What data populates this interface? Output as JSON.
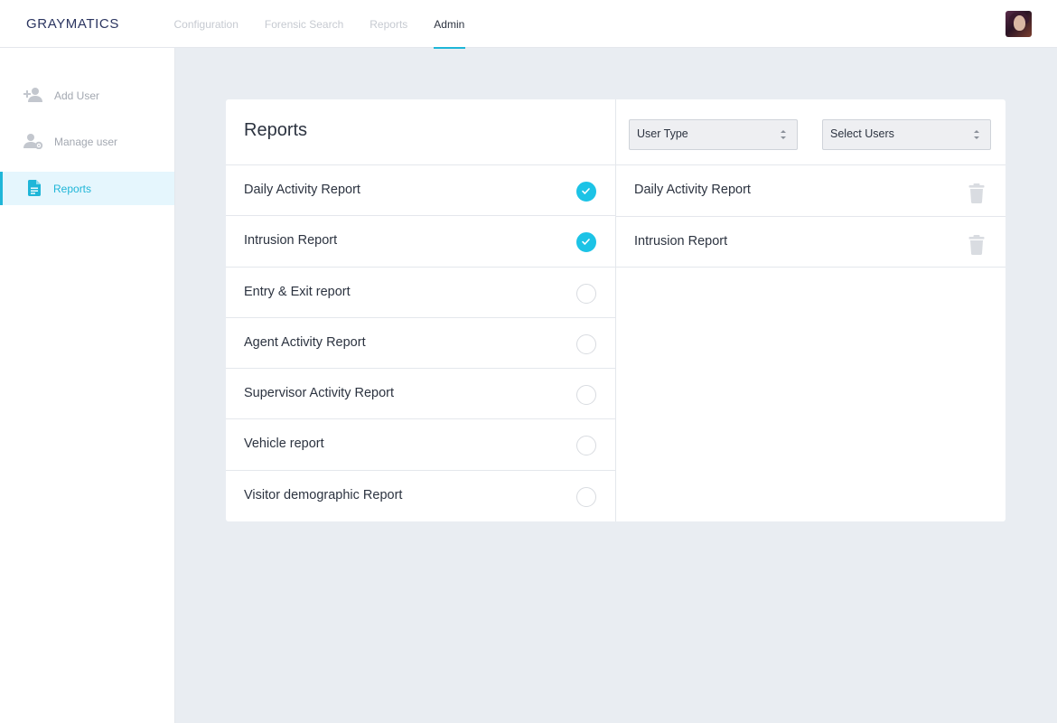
{
  "app": {
    "brand": "GRAYMATICS"
  },
  "nav": [
    {
      "label": "Configuration"
    },
    {
      "label": "Forensic Search"
    },
    {
      "label": "Reports"
    },
    {
      "label": "Admin",
      "active": true
    }
  ],
  "sidebar": {
    "items": [
      {
        "label": "Add User",
        "icon": "add-user-icon"
      },
      {
        "label": "Manage user",
        "icon": "manage-user-icon"
      },
      {
        "label": "Reports",
        "icon": "document-icon",
        "active": true
      }
    ]
  },
  "reports_panel": {
    "title": "Reports",
    "items": [
      {
        "label": "Daily Activity Report",
        "checked": true
      },
      {
        "label": "Intrusion Report",
        "checked": true
      },
      {
        "label": "Entry & Exit report",
        "checked": false
      },
      {
        "label": "Agent Activity Report",
        "checked": false
      },
      {
        "label": "Supervisor Activity Report",
        "checked": false
      },
      {
        "label": "Vehicle report",
        "checked": false
      },
      {
        "label": "Visitor demographic Report",
        "checked": false
      }
    ]
  },
  "assignment_panel": {
    "user_type_select": {
      "value": "User Type"
    },
    "users_select": {
      "value": "Select Users"
    },
    "selected": [
      {
        "label": "Daily Activity Report"
      },
      {
        "label": "Intrusion Report"
      }
    ]
  },
  "colors": {
    "accent": "#1fb6d8",
    "check": "#1cc3e6",
    "background": "#e9edf2",
    "brand": "#2b3560"
  }
}
